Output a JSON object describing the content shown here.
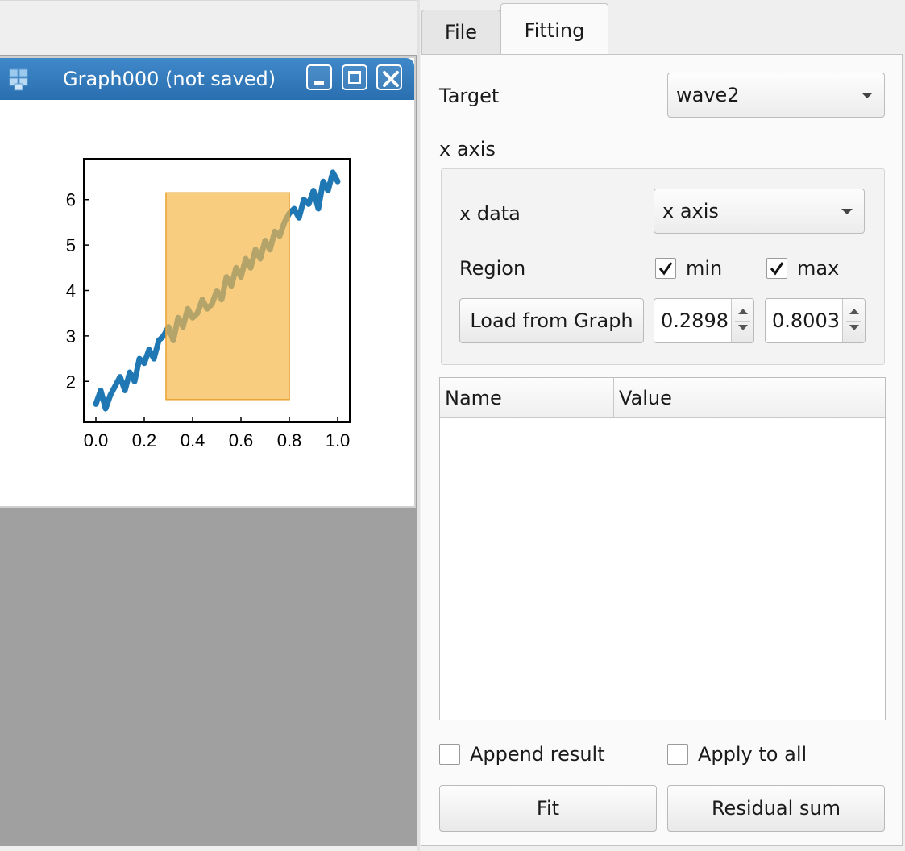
{
  "graph_window": {
    "title": "Graph000 (not saved)",
    "icons": {
      "app": "cube-stack-icon",
      "minimize": "minimize-icon",
      "maximize": "maximize-icon",
      "close": "close-icon"
    }
  },
  "chart_data": {
    "type": "line",
    "title": "",
    "xlabel": "",
    "ylabel": "",
    "xlim": [
      -0.05,
      1.05
    ],
    "ylim": [
      1.1,
      6.9
    ],
    "xticks": [
      "0.0",
      "0.2",
      "0.4",
      "0.6",
      "0.8",
      "1.0"
    ],
    "yticks": [
      "2",
      "3",
      "4",
      "5",
      "6"
    ],
    "series": [
      {
        "color": "#1f77b4",
        "x": [
          0.0,
          0.02,
          0.04,
          0.06,
          0.08,
          0.1,
          0.12,
          0.14,
          0.16,
          0.18,
          0.2,
          0.22,
          0.24,
          0.26,
          0.28,
          0.3,
          0.32,
          0.34,
          0.36,
          0.38,
          0.4,
          0.42,
          0.44,
          0.46,
          0.48,
          0.5,
          0.52,
          0.54,
          0.56,
          0.58,
          0.6,
          0.62,
          0.64,
          0.66,
          0.68,
          0.7,
          0.72,
          0.74,
          0.76,
          0.78,
          0.8,
          0.82,
          0.84,
          0.86,
          0.88,
          0.9,
          0.92,
          0.94,
          0.96,
          0.98,
          1.0
        ],
        "y": [
          1.5,
          1.8,
          1.4,
          1.7,
          1.9,
          2.1,
          1.8,
          2.2,
          2.0,
          2.5,
          2.4,
          2.7,
          2.5,
          2.9,
          3.0,
          3.2,
          2.9,
          3.4,
          3.2,
          3.6,
          3.4,
          3.5,
          3.8,
          3.6,
          3.7,
          4.0,
          3.8,
          4.3,
          4.1,
          4.5,
          4.3,
          4.7,
          4.5,
          4.9,
          4.7,
          5.1,
          4.9,
          5.3,
          5.2,
          5.5,
          5.7,
          5.8,
          5.6,
          6.0,
          5.9,
          6.2,
          5.8,
          6.4,
          6.2,
          6.6,
          6.4
        ]
      }
    ],
    "region": {
      "xmin": 0.2898,
      "xmax": 0.8003,
      "color": "#f5b84a"
    }
  },
  "tabs": [
    {
      "label": "File",
      "active": false
    },
    {
      "label": "Fitting",
      "active": true
    }
  ],
  "fitting": {
    "target_label": "Target",
    "target_value": "wave2",
    "x_axis_header": "x axis",
    "x_data_label": "x data",
    "x_data_value": "x axis",
    "region_label": "Region",
    "min_label": "min",
    "min_checked": true,
    "max_label": "max",
    "max_checked": true,
    "load_button": "Load from Graph",
    "min_value": "0.2898",
    "max_value": "0.8003",
    "table_headers": [
      "Name",
      "Value"
    ],
    "append_result_label": "Append result",
    "append_result_checked": false,
    "apply_to_all_label": "Apply to all",
    "apply_to_all_checked": false,
    "fit_button": "Fit",
    "residual_button": "Residual sum"
  }
}
